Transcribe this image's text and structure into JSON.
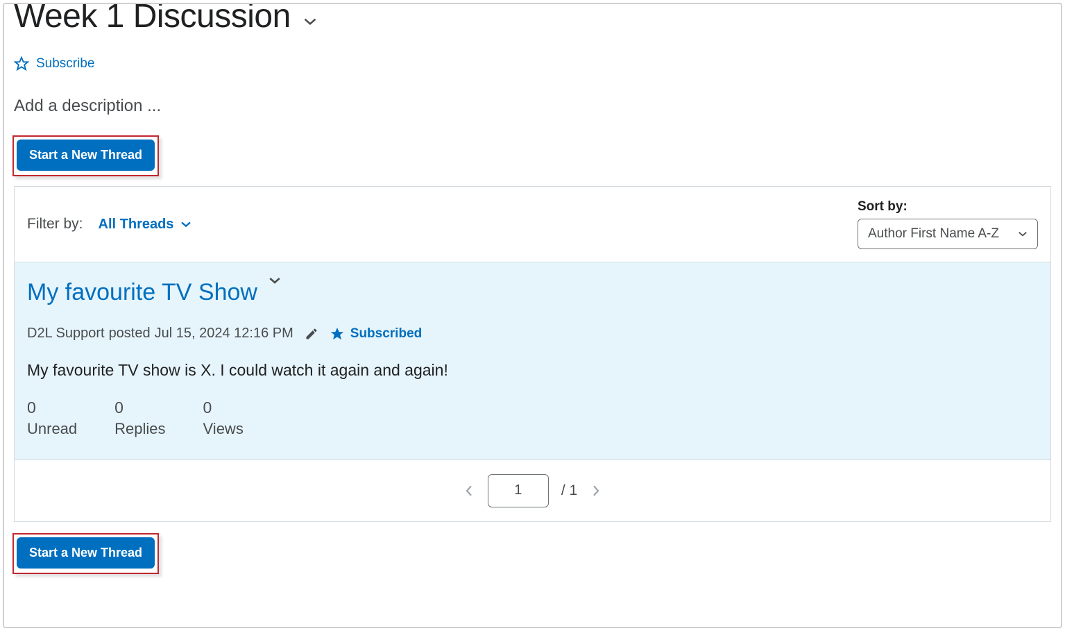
{
  "page": {
    "title": "Week 1 Discussion",
    "subscribe_label": "Subscribe",
    "description_placeholder": "Add a description ...",
    "start_thread_label": "Start a New Thread"
  },
  "filter": {
    "label": "Filter by:",
    "value": "All Threads"
  },
  "sort": {
    "label": "Sort by:",
    "value": "Author First Name A-Z"
  },
  "thread": {
    "title": "My favourite TV Show",
    "author": "D2L Support",
    "posted_verb": "posted",
    "posted_at": "Jul 15, 2024 12:16 PM",
    "subscribed_label": "Subscribed",
    "body": "My favourite TV show is X. I could watch it again and again!",
    "stats": {
      "unread": {
        "count": "0",
        "label": "Unread"
      },
      "replies": {
        "count": "0",
        "label": "Replies"
      },
      "views": {
        "count": "0",
        "label": "Views"
      }
    }
  },
  "pager": {
    "current": "1",
    "total_text": "/  1"
  }
}
